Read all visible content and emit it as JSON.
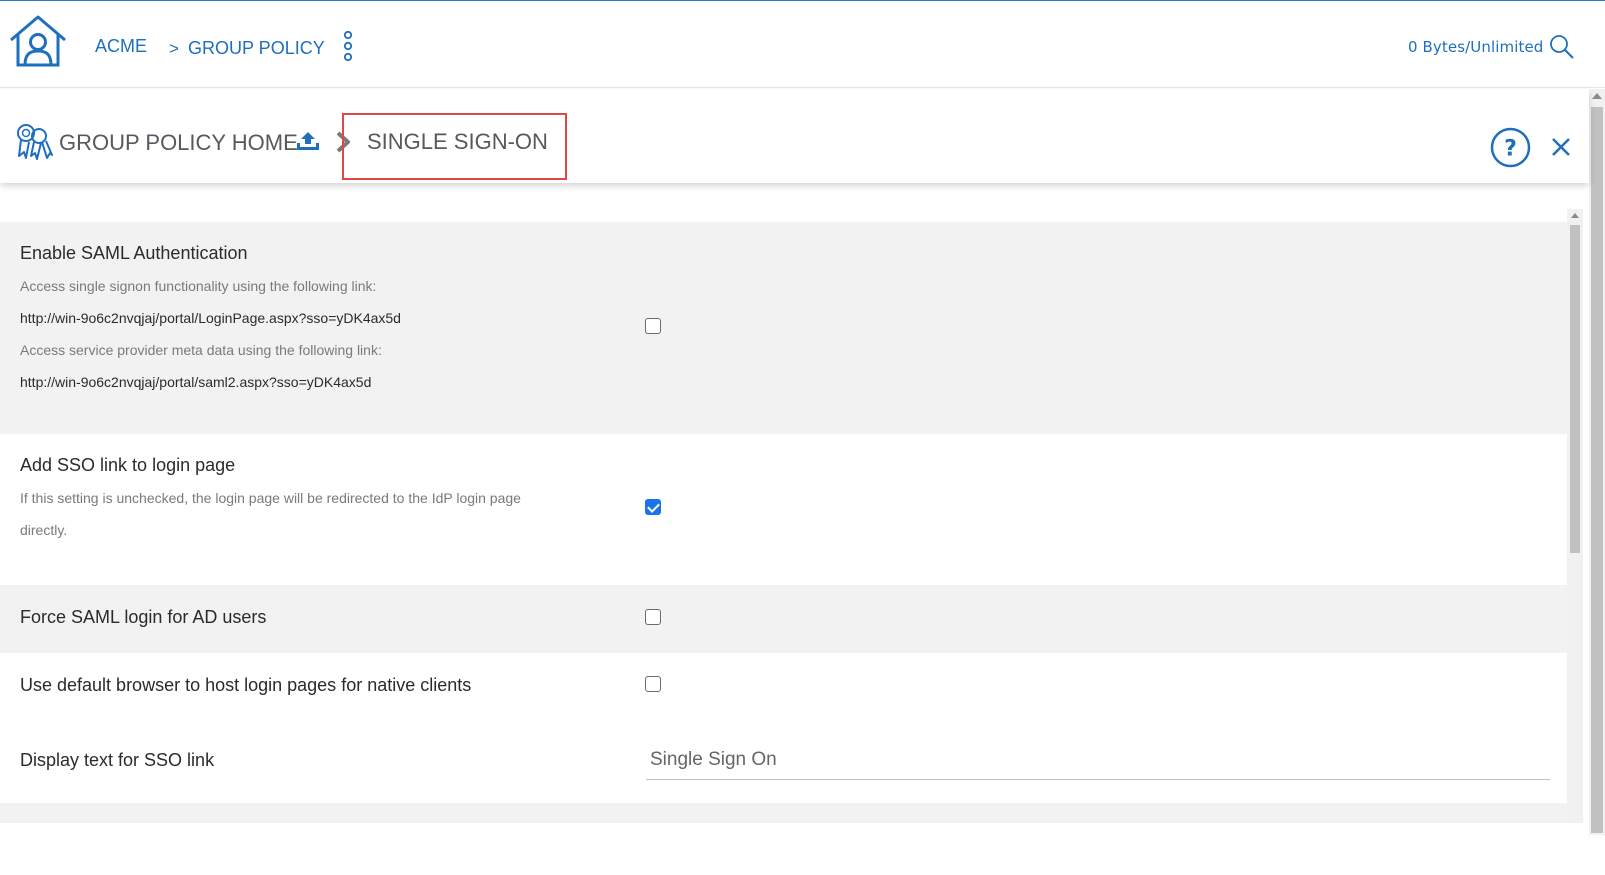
{
  "header": {
    "breadcrumb_root": "ACME",
    "breadcrumb_separator": ">",
    "breadcrumb_current": "GROUP POLICY",
    "storage_text": "0 Bytes/Unlimited",
    "home_icon": "home-user-icon",
    "menu_icon": "kebab-menu-icon",
    "search_icon": "search-icon",
    "accent_color": "#1f6fbf"
  },
  "page_header": {
    "home_label": "GROUP POLICY HOME",
    "current_label": "SINGLE SIGN-ON",
    "policy_icon": "group-policy-icon",
    "upload_icon": "upload-icon",
    "separator_icon": "chevron-right-icon",
    "help_icon": "help-icon",
    "close_icon": "close-icon",
    "highlight_color": "#e04848"
  },
  "settings": {
    "saml": {
      "title": "Enable SAML Authentication",
      "desc1": "Access single signon functionality using the following link:",
      "link1": "http://win-9o6c2nvqjaj/portal/LoginPage.aspx?sso=yDK4ax5d",
      "desc2": "Access service provider meta data using the following link:",
      "link2": "http://win-9o6c2nvqjaj/portal/saml2.aspx?sso=yDK4ax5d",
      "checked": false
    },
    "sso_link": {
      "title": "Add SSO link to login page",
      "desc_line1": "If this setting is unchecked, the login page will be redirected to the IdP login page",
      "desc_line2": "directly.",
      "checked": true
    },
    "force_saml": {
      "title": "Force SAML login for AD users",
      "checked": false
    },
    "default_browser": {
      "title": "Use default browser to host login pages for native clients",
      "checked": false
    },
    "display_text": {
      "title": "Display text for SSO link",
      "value": "Single Sign On"
    }
  }
}
